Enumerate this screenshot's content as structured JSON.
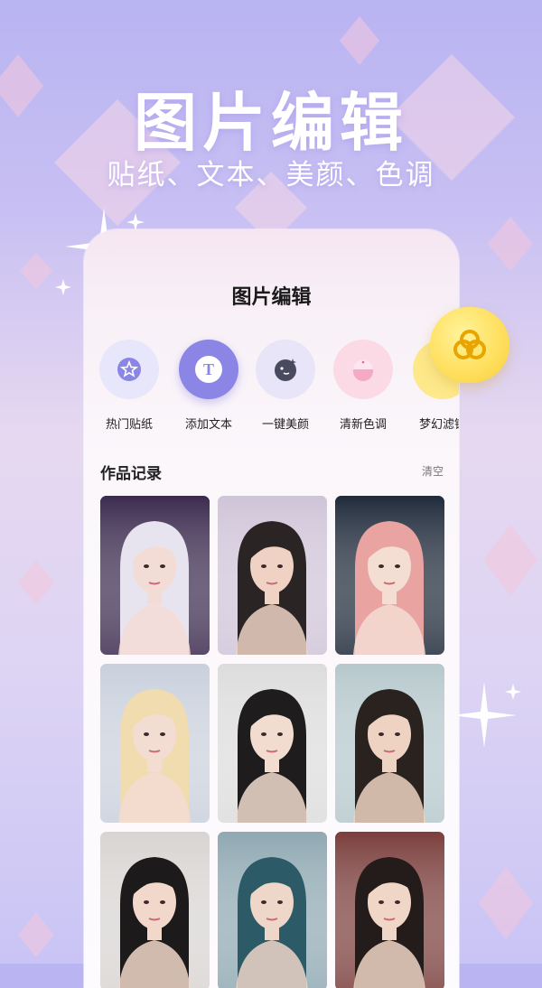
{
  "hero": {
    "title": "图片编辑",
    "subtitle": "贴纸、文本、美颜、色调"
  },
  "card": {
    "title": "图片编辑",
    "tools": [
      {
        "label": "热门贴纸",
        "icon": "sticker-star-icon",
        "color": "#e8e6fb"
      },
      {
        "label": "添加文本",
        "icon": "text-t-icon",
        "color": "#8b86e6"
      },
      {
        "label": "一键美颜",
        "icon": "face-sparkle-icon",
        "color": "#e7e5f7"
      },
      {
        "label": "清新色调",
        "icon": "color-drop-icon",
        "color": "#fbd9e5"
      },
      {
        "label": "梦幻滤镜",
        "icon": "filter-rings-icon",
        "color": "#fde88a"
      }
    ],
    "records_title": "作品记录",
    "clear_label": "清空"
  },
  "photos": [
    {
      "name": "portrait-1",
      "bg": "#3b2a4e",
      "hair": "#e8e4ef",
      "skin": "#f3dcd6"
    },
    {
      "name": "portrait-2",
      "bg": "#cfc4d8",
      "hair": "#2a2524",
      "skin": "#efd2c4"
    },
    {
      "name": "portrait-3",
      "bg": "#1f2a3a",
      "hair": "#e9a3a0",
      "skin": "#f4ddd3"
    },
    {
      "name": "portrait-4",
      "bg": "#c9d0dc",
      "hair": "#f1dcb0",
      "skin": "#f3dcd2"
    },
    {
      "name": "portrait-5",
      "bg": "#dcdcdc",
      "hair": "#1e1c1c",
      "skin": "#f2dccf"
    },
    {
      "name": "portrait-6",
      "bg": "#b6c8cc",
      "hair": "#2a221f",
      "skin": "#eed3c3"
    },
    {
      "name": "portrait-7",
      "bg": "#d8d4d2",
      "hair": "#1c1a1a",
      "skin": "#f1d8ca"
    },
    {
      "name": "portrait-8",
      "bg": "#8fa8b2",
      "hair": "#2c5a66",
      "skin": "#eed6c9"
    },
    {
      "name": "portrait-9",
      "bg": "#7a3e3c",
      "hair": "#241c1a",
      "skin": "#f0d6c7"
    }
  ],
  "colors": {
    "accent": "#8b86e6",
    "float_button": "#ffe060"
  }
}
